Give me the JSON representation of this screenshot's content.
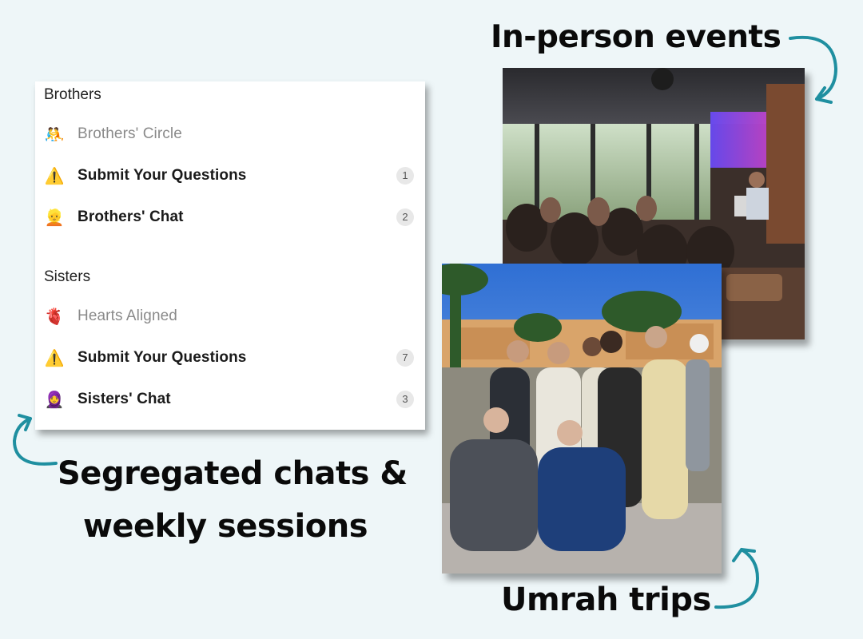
{
  "captions": {
    "events": "In-person events",
    "segregated_line1": "Segregated chats &",
    "segregated_line2": "weekly sessions",
    "umrah": "Umrah trips"
  },
  "panel": {
    "brothers": {
      "title": "Brothers",
      "items": [
        {
          "emoji": "🤼",
          "label": "Brothers' Circle",
          "badge": ""
        },
        {
          "emoji": "⚠️",
          "label": "Submit Your Questions",
          "badge": "1"
        },
        {
          "emoji": "👱",
          "label": "Brothers' Chat",
          "badge": "2"
        }
      ]
    },
    "sisters": {
      "title": "Sisters",
      "items": [
        {
          "emoji": "🫀",
          "label": "Hearts Aligned",
          "badge": ""
        },
        {
          "emoji": "⚠️",
          "label": "Submit Your Questions",
          "badge": "7"
        },
        {
          "emoji": "🧕",
          "label": "Sisters' Chat",
          "badge": "3"
        }
      ]
    }
  },
  "colors": {
    "background": "#eef6f8",
    "arrow": "#1f8fa0",
    "badge_bg": "#e8e8e8"
  }
}
